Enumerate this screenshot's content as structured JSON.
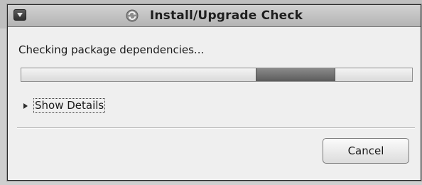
{
  "window": {
    "title": "Install/Upgrade Check",
    "menu_icon": "menu-down-icon",
    "title_icon": "sync-icon"
  },
  "content": {
    "status_text": "Checking package dependencies...",
    "progress": {
      "indeterminate": true,
      "block_start_fraction": 0.6,
      "block_end_fraction": 0.8
    },
    "details_toggle_label": "Show Details",
    "details_toggle_icon": "triangle-right-icon",
    "cancel_label": "Cancel"
  }
}
